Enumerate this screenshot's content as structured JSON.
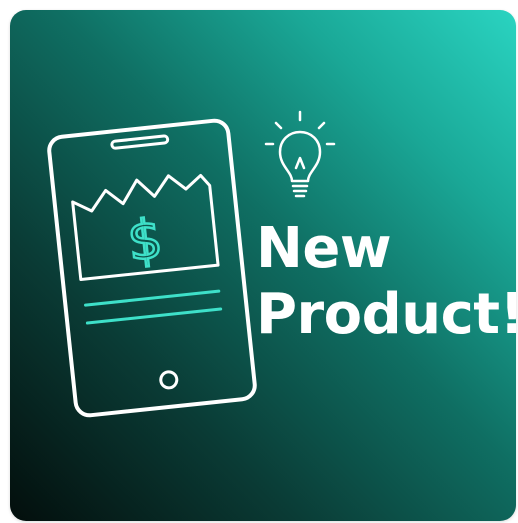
{
  "headline": {
    "line1": "New",
    "line2": "Product!"
  },
  "illustration": {
    "device_icon": "smartphone-icon",
    "currency_symbol": "$",
    "idea_icon": "lightbulb-icon"
  },
  "colors": {
    "gradient_dark": "#030e0c",
    "gradient_mid": "#0f6f63",
    "gradient_light": "#2ad4c1",
    "accent_line": "#3ee0c9",
    "outline": "#ffffff"
  }
}
